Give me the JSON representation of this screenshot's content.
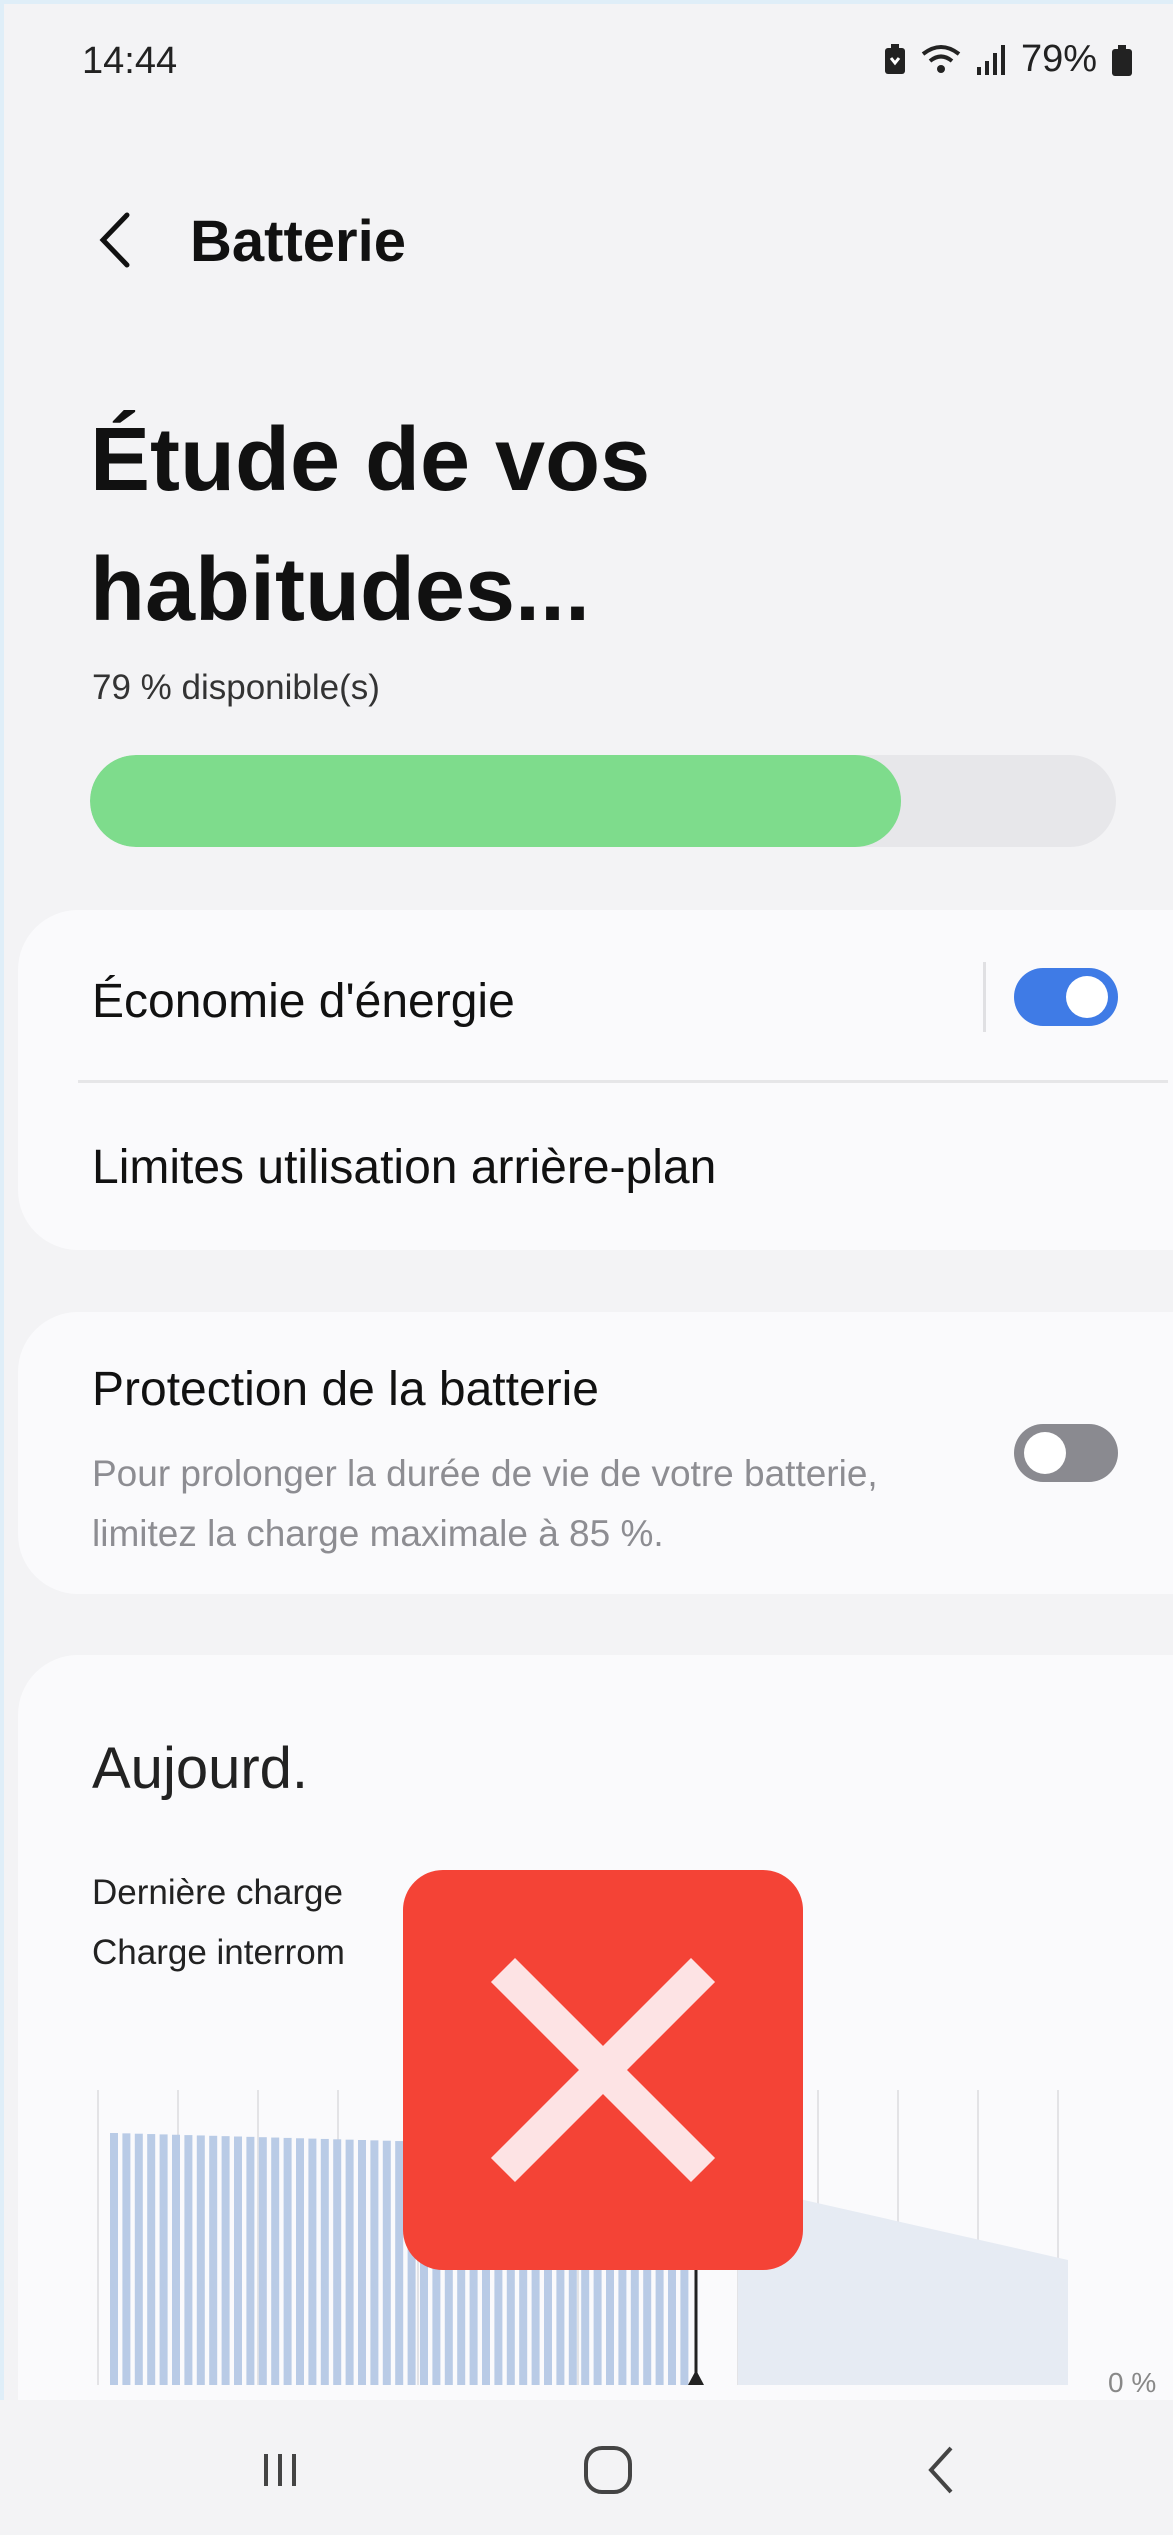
{
  "status_bar": {
    "time": "14:44",
    "battery_percent": "79%",
    "icons": [
      "battery-saver-icon",
      "wifi-icon",
      "signal-icon",
      "battery-icon"
    ]
  },
  "header": {
    "title": "Batterie",
    "back_icon": "chevron-left-icon"
  },
  "main": {
    "heading": "Étude de vos habitudes...",
    "available": "79 % disponible(s)",
    "battery_level": 0.79,
    "fill_color": "#7edc8c"
  },
  "settings": {
    "power_saving": {
      "label": "Économie d'énergie",
      "enabled": true
    },
    "background_limits": {
      "label": "Limites utilisation arrière-plan"
    },
    "battery_protection": {
      "label": "Protection de la batterie",
      "description": "Pour prolonger la durée de vie de votre batterie, limitez la charge maximale à 85 %.",
      "enabled": false
    }
  },
  "usage": {
    "title": "Aujourd.",
    "last_charge": "Dernière charge",
    "charge_interrupted": "Charge interrom",
    "axis_label": "0 %"
  },
  "overlay": {
    "icon": "close-icon",
    "color": "#f44336"
  },
  "navbar": {
    "icons": [
      "recent-apps-icon",
      "home-icon",
      "back-icon"
    ]
  },
  "colors": {
    "accent": "#3f7be6",
    "background": "#f3f3f5",
    "card": "#fafafc"
  }
}
